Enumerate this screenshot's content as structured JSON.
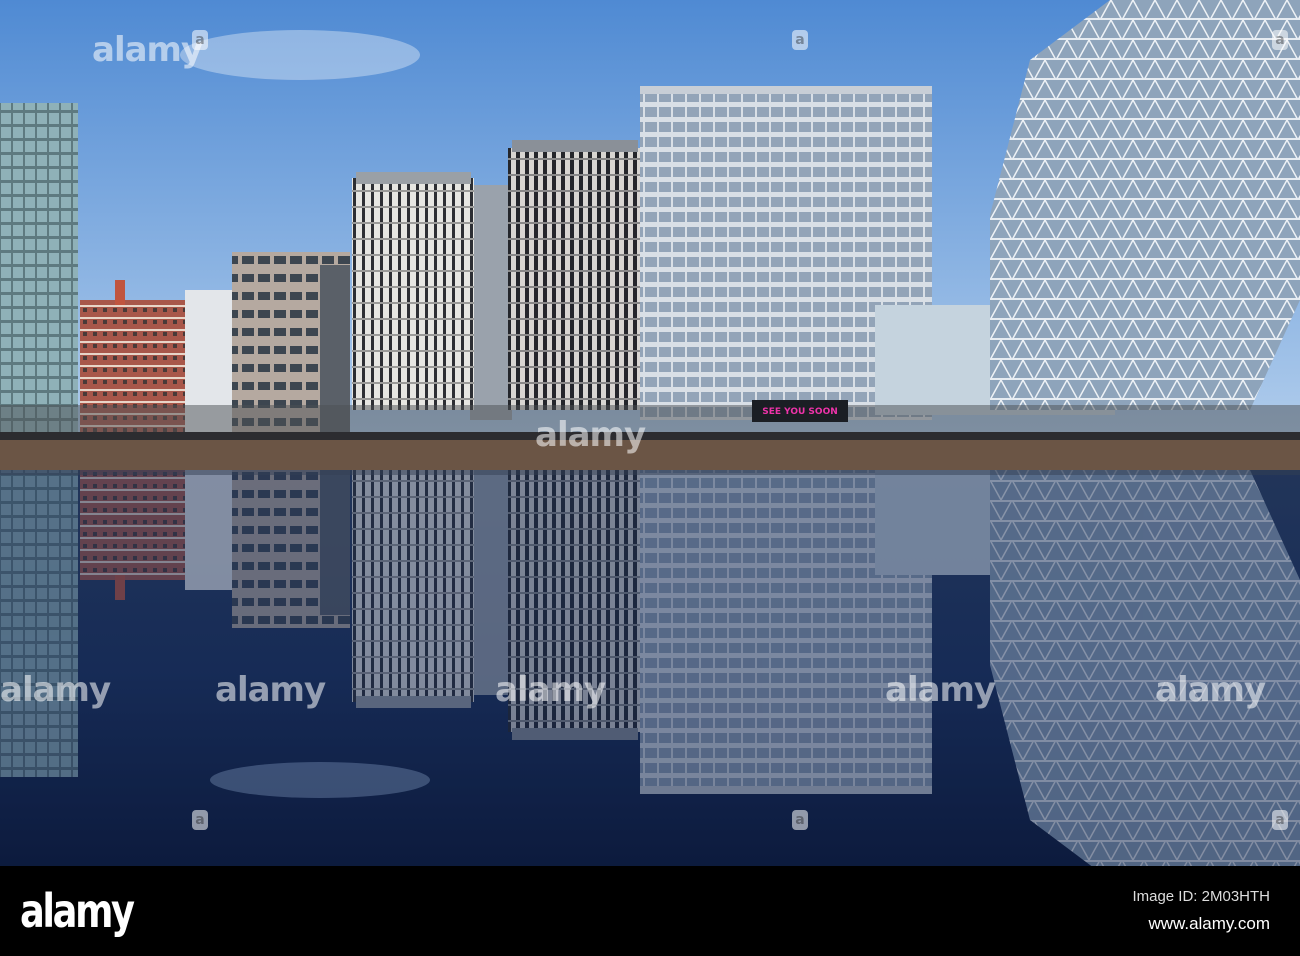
{
  "photo": {
    "sign_text": "SEE YOU SOON",
    "colors": {
      "sky_top": "#5a92d6",
      "sky_bottom": "#b9d3ef",
      "water_top": "#23365a",
      "water_bottom": "#0d1a3a",
      "quay": "#6b5545"
    }
  },
  "watermark": {
    "text": "alamy",
    "logo_letter": "a"
  },
  "footer": {
    "logo": "alamy",
    "image_id": "Image ID: 2M03HTH",
    "url": "www.alamy.com"
  }
}
